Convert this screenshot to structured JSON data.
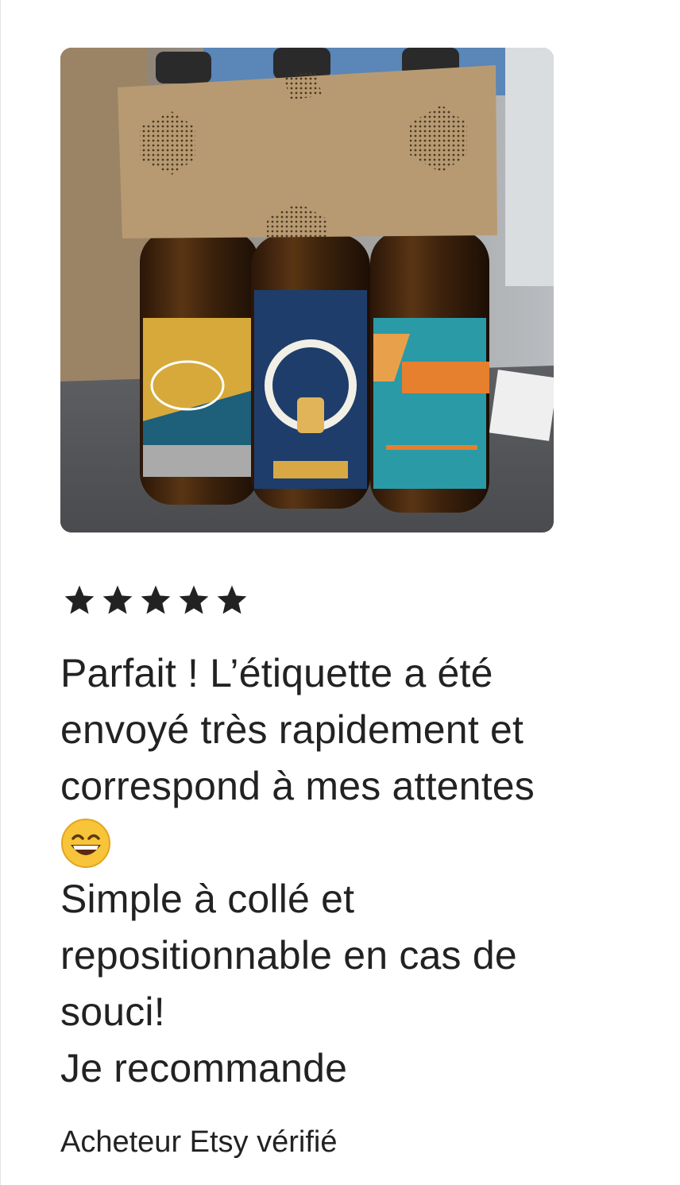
{
  "review": {
    "photo_alt": "review-photo",
    "rating": 5,
    "max_rating": 5,
    "lines": [
      "Parfait ! L’étiquette a été",
      "envoyé très rapidement et",
      "correspond à mes attentes",
      "😄",
      "Simple à collé et",
      "repositionnable en cas de",
      "souci!",
      "Je recommande"
    ],
    "buyer_label": "Acheteur Etsy vérifié"
  },
  "colors": {
    "text": "#222222",
    "star": "#222222"
  },
  "icons": {
    "star": "star-icon",
    "emoji": "grinning-face-emoji"
  }
}
